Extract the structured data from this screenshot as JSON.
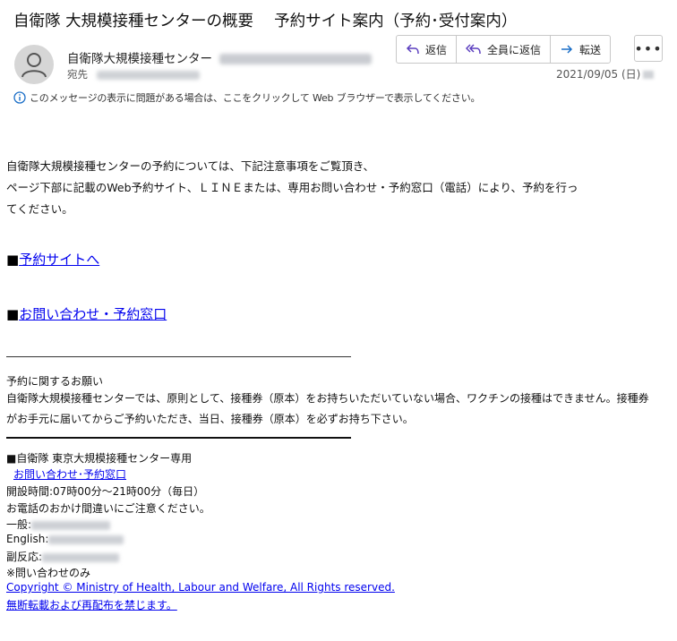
{
  "email": {
    "subject": "自衛隊 大規模接種センターの概要　 予約サイト案内（予約･受付案内）",
    "sender_name": "自衛隊大規模接種センター",
    "to_label": "宛先",
    "date": "2021/09/05 (日)"
  },
  "actions": {
    "reply": "返信",
    "reply_all": "全員に返信",
    "forward": "転送",
    "more": "•••"
  },
  "info_bar": {
    "text": "このメッセージの表示に問題がある場合は、ここをクリックして Web ブラウザーで表示してください。"
  },
  "body": {
    "para1_line1": "自衛隊大規模接種センターの予約については、下記注意事項をご覧頂き、",
    "para1_line2": "ページ下部に記載のWeb予約サイト、ＬＩＮＥまたは、専用お問い合わせ・予約窓口（電話）により、予約を行っ",
    "para1_line3": "てください。",
    "bullet": "■",
    "link_reservation": "予約サイトへ",
    "link_contact": "お問い合わせ・予約窓口",
    "notice_title": "予約に関するお願い",
    "notice_line1": "自衛隊大規模接種センターでは、原則として、接種券（原本）をお持ちいただいていない場合、ワクチンの接種はできません。接種券",
    "notice_line2": "がお手元に届いてからご予約いただき、当日、接種券（原本）を必ずお持ち下さい。"
  },
  "footer": {
    "center_name": "■自衛隊 東京大規模接種センター専用",
    "contact_link": "お問い合わせ･予約窓口",
    "hours": "開設時間:07時00分～21時00分（毎日）",
    "caution": "お電話のおかけ間違いにご注意ください。",
    "general_label": "一般:",
    "english_label": "English:",
    "side_reaction_label": "副反応:",
    "inquiry_only": "※問い合わせのみ",
    "copyright": "Copyright © Ministry of Health, Labour and Welfare, All Rights reserved.",
    "no_reprint": "無断転載および再配布を禁じます。"
  }
}
